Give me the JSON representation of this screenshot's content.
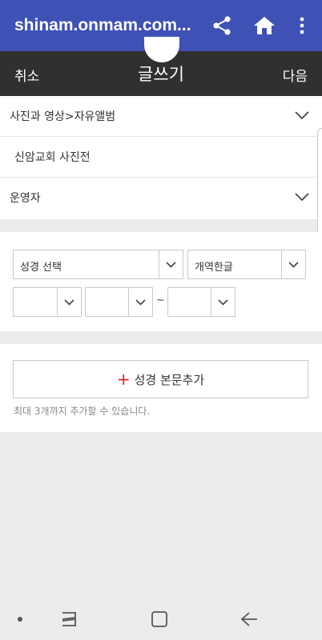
{
  "browser": {
    "url": "shinam.onmam.com...",
    "icons": [
      "share-icon",
      "home-icon",
      "more-vert-icon"
    ]
  },
  "header": {
    "cancel": "취소",
    "title": "글쓰기",
    "next": "다음"
  },
  "form": {
    "category": "사진과 영상>자유앨범",
    "title_value": "신암교회 사진전",
    "author": "운영자"
  },
  "bible": {
    "book_placeholder": "성경 선택",
    "version": "개역한글",
    "chapter": "",
    "verse_from": "",
    "range_separator": "~",
    "verse_to": ""
  },
  "add": {
    "plus": "+",
    "label": "성경 본문추가",
    "hint": "최대 3개까지 추가할 수 있습니다."
  },
  "nav": {
    "icons": [
      "dot-icon",
      "recents-icon",
      "home-button-icon",
      "back-icon"
    ]
  }
}
